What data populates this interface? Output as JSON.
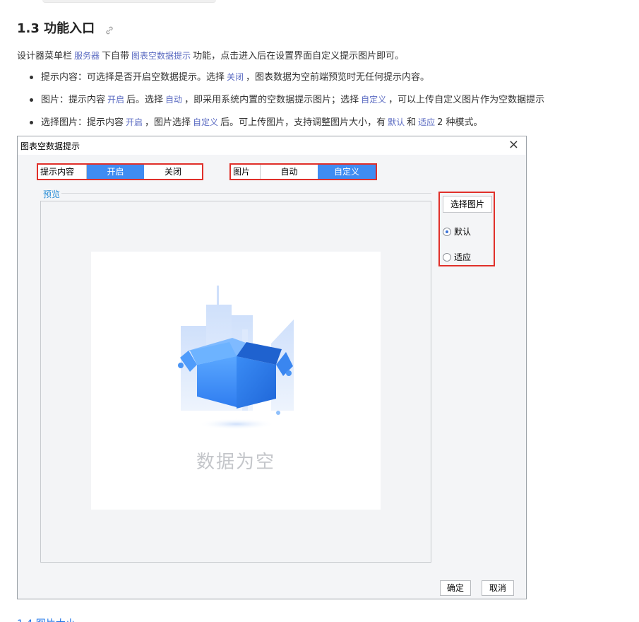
{
  "doc": {
    "heading": "1.3 功能入口",
    "intro": {
      "p1": "设计器菜单栏",
      "k1": "服务器",
      "p2": "下自带",
      "k2": "图表空数据提示",
      "p3": "功能，点击进入后在设置界面自定义提示图片即可。"
    },
    "bullets": [
      {
        "p1": "提示内容：可选择是否开启空数据提示。选择",
        "k1": "关闭",
        "p2": "，图表数据为空前端预览时无任何提示内容。"
      },
      {
        "p1": "图片：提示内容",
        "k1": "开启",
        "p2": "后。选择",
        "k2": "自动",
        "p3": "，即采用系统内置的空数据提示图片；选择",
        "k3": "自定义",
        "p4": "，可以上传自定义图片作为空数据提示"
      },
      {
        "p1": "选择图片：提示内容",
        "k1": "开启",
        "p2": "，图片选择",
        "k2": "自定义",
        "p3": "后。可上传图片，支持调整图片大小，有",
        "k3": "默认",
        "p4": "和",
        "k4": "适应",
        "p5": "2 种模式。"
      }
    ],
    "next_heading": "1.4 图片大小"
  },
  "dialog": {
    "title": "图表空数据提示",
    "close": "×",
    "tip": {
      "label": "提示内容",
      "options": [
        "开启",
        "关闭"
      ],
      "selected": "开启"
    },
    "image": {
      "label": "图片",
      "options": [
        "自动",
        "自定义"
      ],
      "selected": "自定义"
    },
    "preview_label": "预览",
    "empty_text": "数据为空",
    "pick_button": "选择图片",
    "modes": [
      "默认",
      "适应"
    ],
    "mode_selected": "默认",
    "ok": "确定",
    "cancel": "取消"
  },
  "colors": {
    "accent": "#3f8cf2",
    "highlight_border": "#e0302a",
    "keyword": "#5b6bc2"
  }
}
